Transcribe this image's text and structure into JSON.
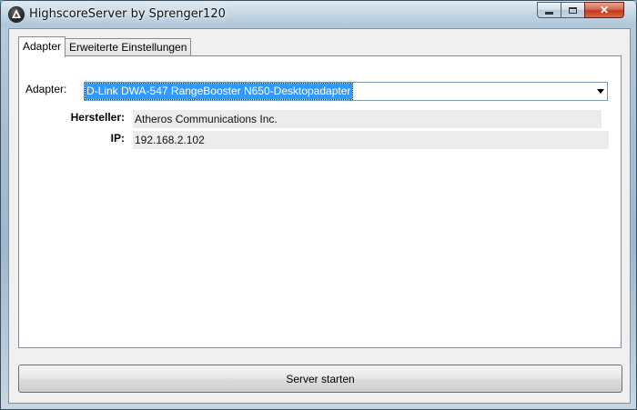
{
  "window": {
    "title": "HighscoreServer by Sprenger120",
    "icon": "app-logo-icon",
    "controls": {
      "minimize": "minimize-icon",
      "maximize": "maximize-icon",
      "close": "close-icon",
      "close_glyph": "✕"
    }
  },
  "tabs": [
    {
      "label": "Adapter",
      "active": true
    },
    {
      "label": "Erweiterte Einstellungen",
      "active": false
    }
  ],
  "adapter_page": {
    "adapter_label": "Adapter:",
    "adapter_selected": "D-Link DWA-547 RangeBooster N650-Desktopadapter",
    "manufacturer_label": "Hersteller:",
    "manufacturer_value": "Atheros Communications Inc.",
    "ip_label": "IP:",
    "ip_value": "192.168.2.102"
  },
  "footer": {
    "start_button": "Server starten"
  },
  "colors": {
    "selection": "#3399ff",
    "close_button": "#c3391c",
    "window_background": "#f0f0f0"
  }
}
